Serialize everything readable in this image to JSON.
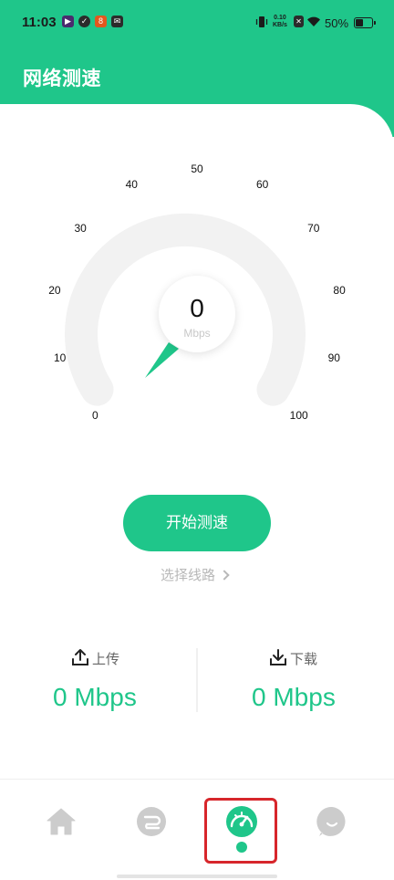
{
  "status_bar": {
    "time": "11:03",
    "net_speed_value": "0.10",
    "net_speed_unit": "KB/s",
    "battery": "50%"
  },
  "header": {
    "title": "网络测速"
  },
  "gauge": {
    "min": 0,
    "max": 100,
    "ticks": [
      "0",
      "10",
      "20",
      "30",
      "40",
      "50",
      "60",
      "70",
      "80",
      "90",
      "100"
    ],
    "current_value": "0",
    "unit": "Mbps"
  },
  "actions": {
    "start_label": "开始测速",
    "route_label": "选择线路"
  },
  "stats": {
    "upload": {
      "label": "上传",
      "value": "0 Mbps"
    },
    "download": {
      "label": "下载",
      "value": "0 Mbps"
    }
  },
  "bottom_nav": {
    "items": [
      {
        "icon": "home-icon"
      },
      {
        "icon": "route-icon"
      },
      {
        "icon": "speedometer-icon",
        "active": true
      },
      {
        "icon": "profile-icon"
      }
    ]
  },
  "colors": {
    "brand": "#1fc68a",
    "highlight": "#d7262b"
  }
}
